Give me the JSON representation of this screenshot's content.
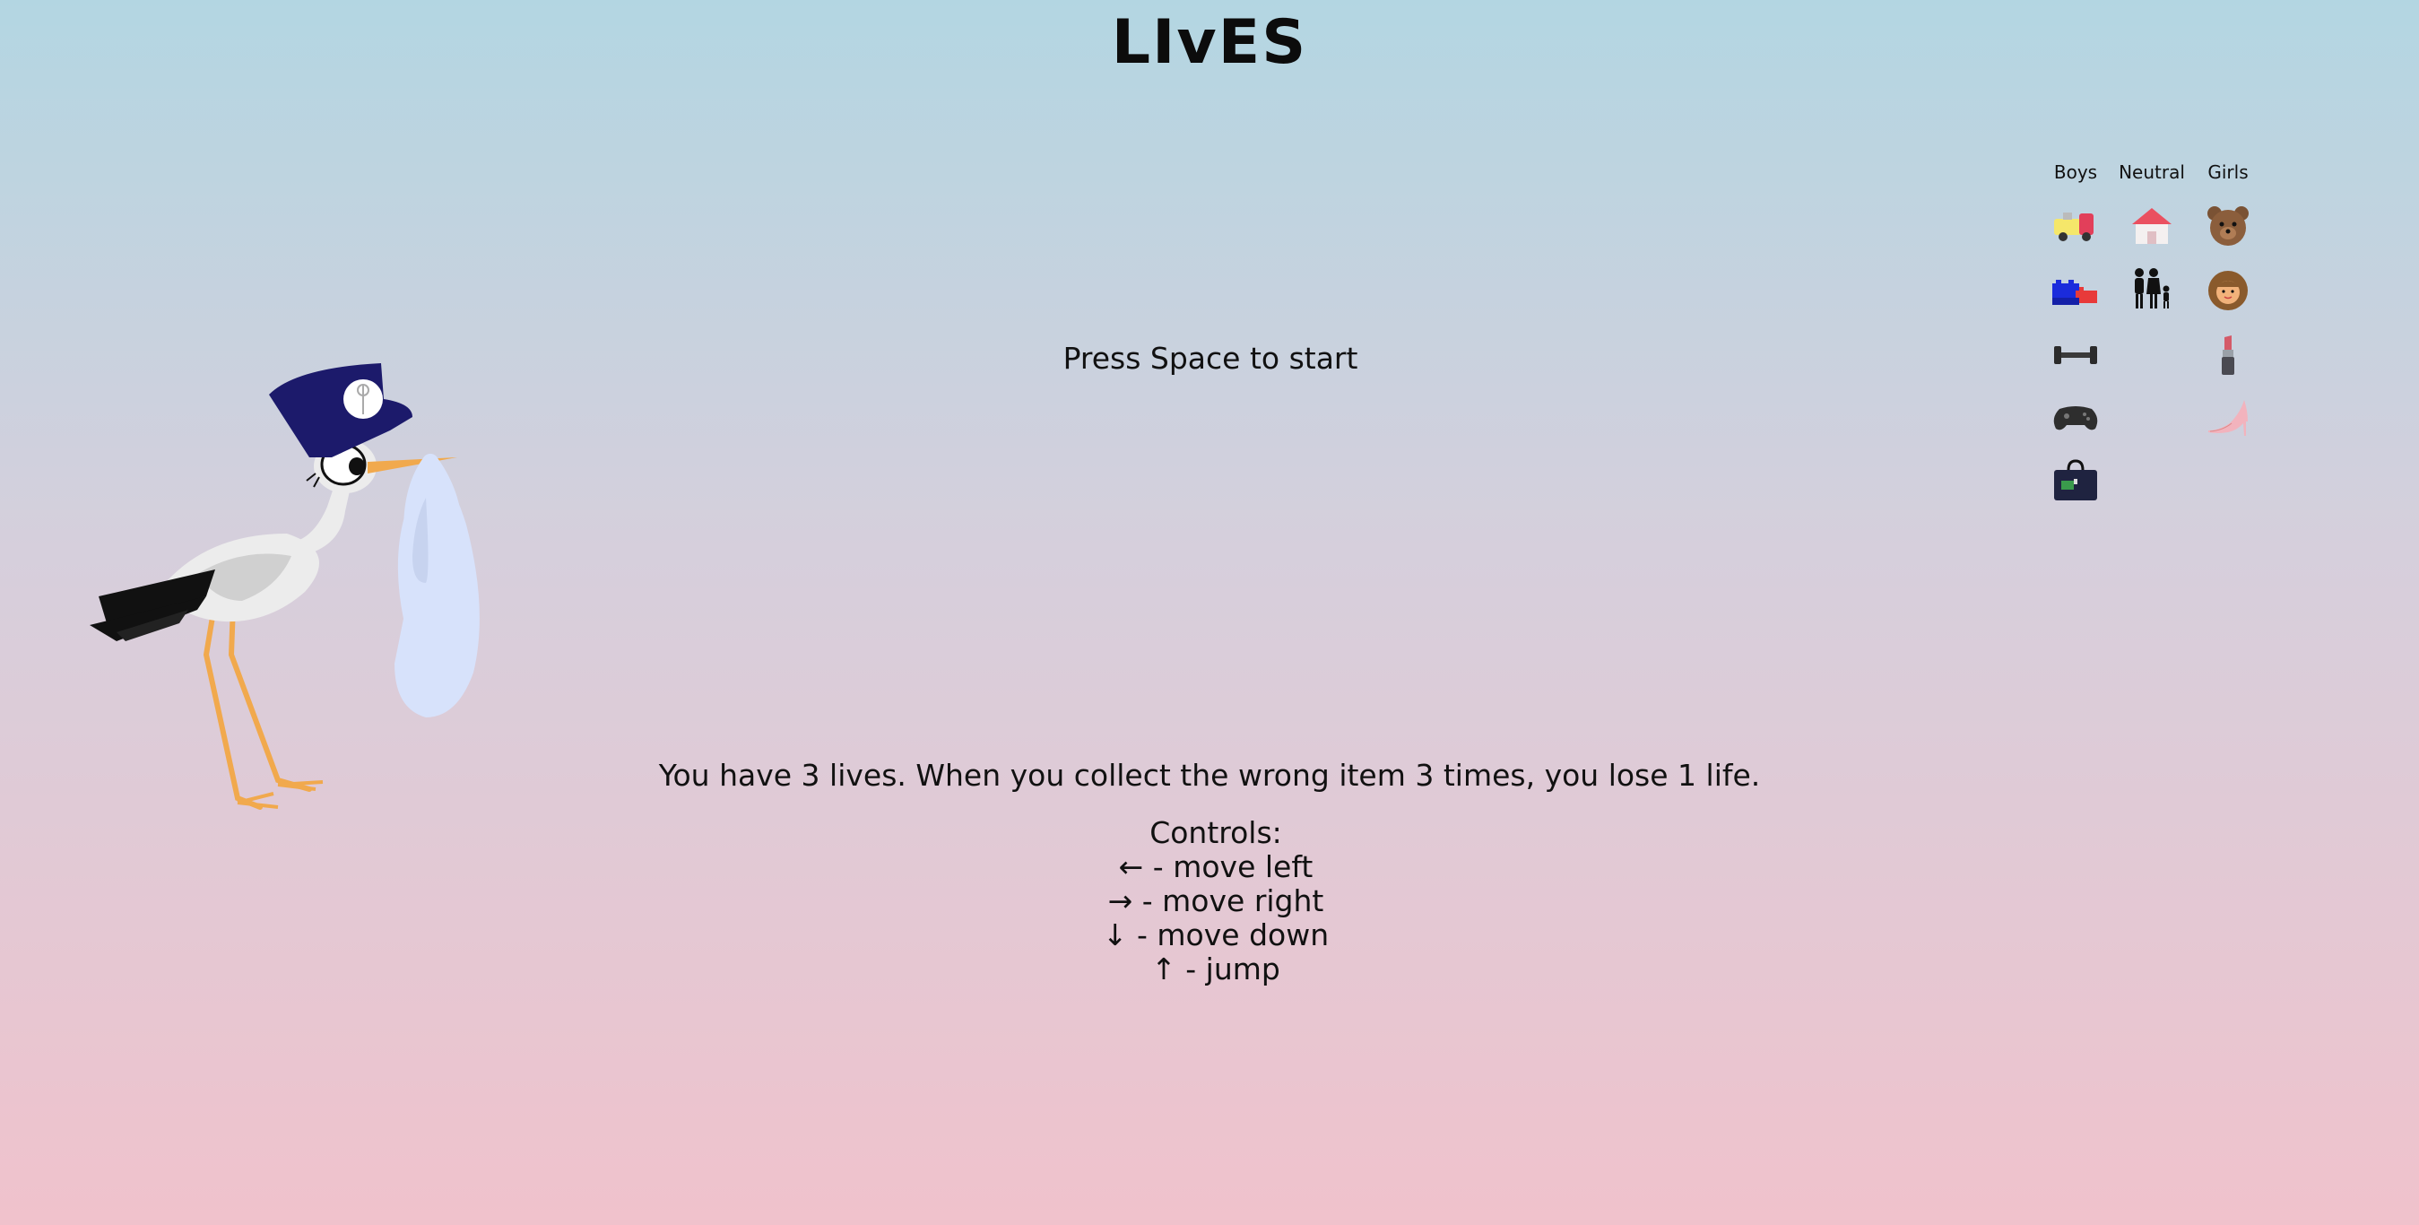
{
  "title": "LIvES",
  "start_prompt": "Press Space to start",
  "lives_info": "You have 3 lives. When you collect the wrong item 3 times, you lose 1 life.",
  "controls": {
    "heading": "Controls:",
    "lines": [
      "← - move left",
      "→ - move right",
      "↓ - move down",
      "↑ - jump"
    ]
  },
  "legend": {
    "headers": [
      "Boys",
      "Neutral",
      "Girls"
    ],
    "boys_icons": [
      "toy-truck-icon",
      "building-blocks-icon",
      "dumbbell-icon",
      "game-controller-icon",
      "briefcase-icon"
    ],
    "neutral_icons": [
      "house-icon",
      "family-icon"
    ],
    "girls_icons": [
      "teddy-bear-icon",
      "doll-icon",
      "lipstick-icon",
      "high-heel-icon"
    ]
  },
  "colors": {
    "background_top": "#b3d6e2",
    "background_bottom": "#f0c2cc",
    "stork_hat": "#1c1a6b",
    "stork_beak": "#f1a94d",
    "bundle": "#d7e2fb"
  }
}
